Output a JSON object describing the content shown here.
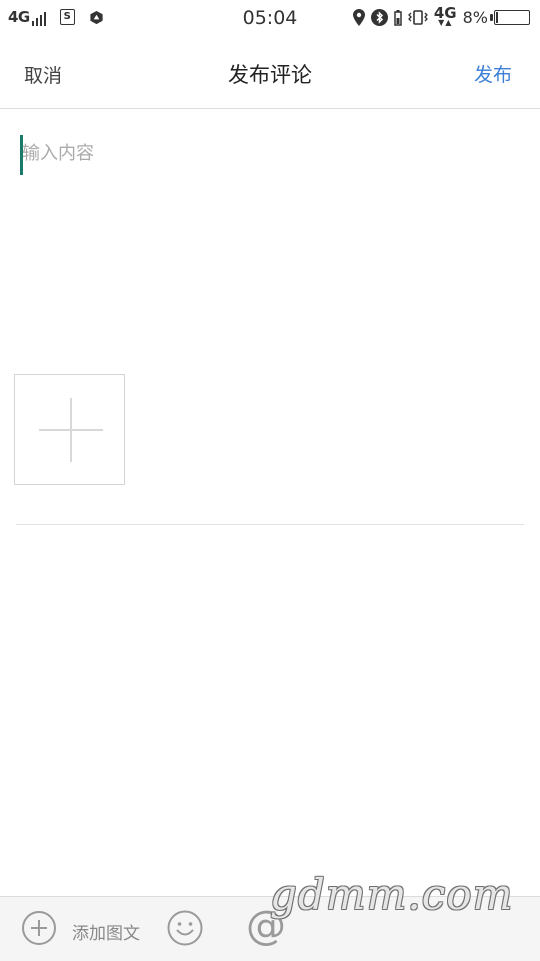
{
  "status_bar": {
    "network": "4G",
    "sim_label": "S",
    "time": "05:04",
    "network_right": "4G",
    "battery_percent_text": "8%",
    "battery_level": 0.08
  },
  "header": {
    "cancel_label": "取消",
    "title": "发布评论",
    "publish_label": "发布"
  },
  "editor": {
    "value": "",
    "placeholder": "输入内容"
  },
  "toolbar": {
    "add_label": "添加图文",
    "at_symbol": "@"
  },
  "watermark": "gdmm.com",
  "colors": {
    "accent_blue": "#3b7fd6",
    "caret": "#1a7a6a",
    "toolbar_bg": "#f5f5f5"
  }
}
